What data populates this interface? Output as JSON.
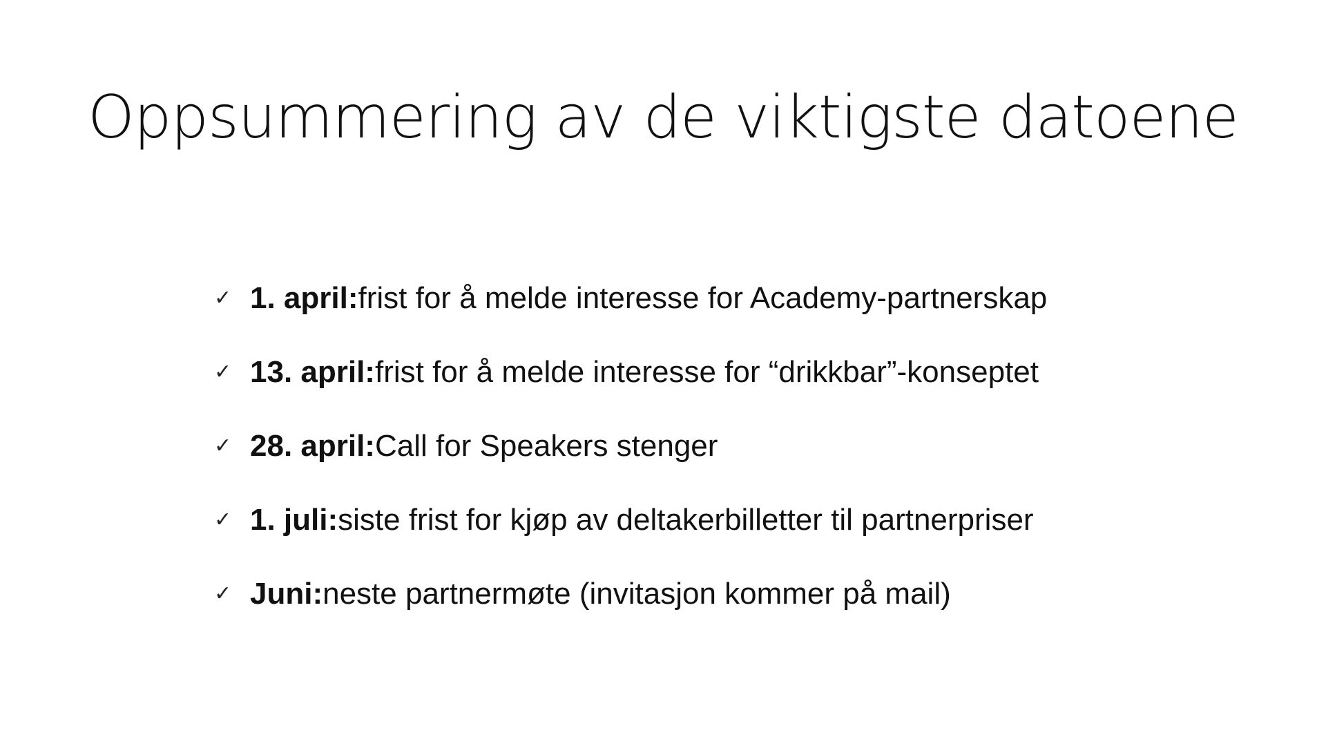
{
  "slide": {
    "title": "Oppsummering av de viktigste datoene",
    "items": [
      {
        "icon": "checkmark-icon",
        "date": "1. april:",
        "text": " frist for å melde interesse for Academy-partnerskap"
      },
      {
        "icon": "checkmark-icon",
        "date": "13. april:",
        "text": " frist for å melde interesse for “drikkbar”-konseptet"
      },
      {
        "icon": "checkmark-icon",
        "date": "28. april:",
        "text": " Call for Speakers stenger"
      },
      {
        "icon": "checkmark-icon",
        "date": "1. juli:",
        "text": " siste frist for kjøp av deltakerbilletter til partnerpriser"
      },
      {
        "icon": "checkmark-icon",
        "date": "Juni:",
        "text": " neste partnermøte (invitasjon kommer på mail)"
      }
    ]
  }
}
